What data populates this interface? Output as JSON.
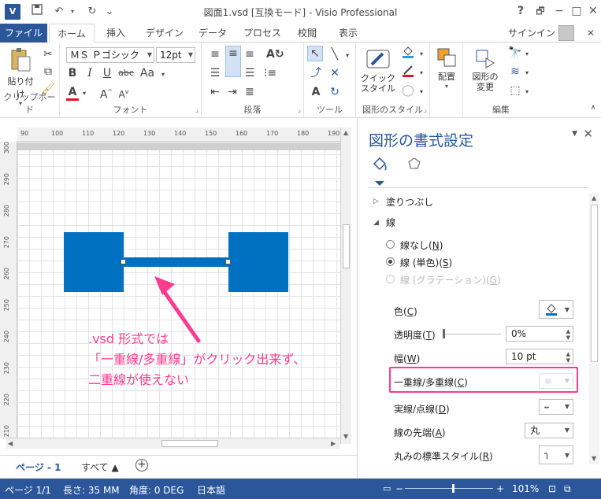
{
  "window": {
    "title": "図面1.vsd  [互換モード] - Visio Professional",
    "app_icon": "V",
    "help": "?",
    "restore": "🗗",
    "minimize": "−",
    "maximize": "□",
    "close": "✕"
  },
  "quick_access": {
    "save_icon": "save-icon",
    "undo": "↶",
    "redo": "↻",
    "customize": "⌄"
  },
  "tabs": [
    "ファイル",
    "ホーム",
    "挿入",
    "デザイン",
    "データ",
    "プロセス",
    "校閲",
    "表示"
  ],
  "active_tab": "ホーム",
  "signin": "サインイン",
  "ribbon": {
    "clipboard": {
      "label": "クリップボード",
      "paste": "貼り付け"
    },
    "font": {
      "label": "フォント",
      "font_name": "ＭＳ Ｐゴシック",
      "font_size": "12pt",
      "bold": "B",
      "italic": "I",
      "underline": "U",
      "strike": "abc",
      "aa_change": "Aa",
      "grow": "A",
      "shrink": "A",
      "color": "A"
    },
    "paragraph": {
      "label": "段落"
    },
    "tools": {
      "label": "ツール"
    },
    "shape_style": {
      "label": "図形のスタイル",
      "quick_style": "クイック\nスタイル"
    },
    "arrange": {
      "label": "",
      "arrange": "配置"
    },
    "edit": {
      "label": "編集",
      "change_shape": "図形の\n変更"
    }
  },
  "ruler": {
    "h_ticks": [
      "90",
      "100",
      "110",
      "120",
      "130",
      "140",
      "150",
      "160",
      "170",
      "180",
      "190"
    ],
    "v_ticks": [
      "300",
      "290",
      "280",
      "270",
      "260",
      "250",
      "240",
      "230",
      "220",
      "210"
    ]
  },
  "annotation": {
    "line1": ".vsd 形式では",
    "line2": "「一重線/多重線」がクリック出来ず、",
    "line3": "二重線が使えない"
  },
  "page_tabs": {
    "page1": "ページ - 1",
    "all": "すべて ▲",
    "add": "+"
  },
  "pane": {
    "title": "図形の書式設定",
    "fill_section": "塗りつぶし",
    "line_section": "線",
    "no_line": "線なし",
    "no_line_key": "N",
    "solid_line": "線 (単色)",
    "solid_key": "S",
    "gradient_line": "線 (グラデーション)",
    "gradient_key": "G",
    "color_label": "色",
    "color_key": "C",
    "transparency_label": "透明度",
    "transparency_key": "T",
    "transparency_value": "0%",
    "width_label": "幅",
    "width_key": "W",
    "width_value": "10 pt",
    "compound_label": "一重線/多重線",
    "compound_key": "C",
    "dash_label": "実線/点線",
    "dash_key": "D",
    "cap_label": "線の先端",
    "cap_key": "A",
    "cap_value": "丸",
    "round_label": "丸みの標準スタイル",
    "round_key": "R"
  },
  "statusbar": {
    "page": "ページ 1/1",
    "length": "長さ: 35 MM",
    "angle": "角度: 0 DEG",
    "language": "日本語",
    "zoom": "101%"
  },
  "colors": {
    "accent": "#2b579a",
    "shape_fill": "#0070c0",
    "annotation": "#ff3b8e",
    "font_color_bar": "#e81123"
  },
  "transparency": 0
}
